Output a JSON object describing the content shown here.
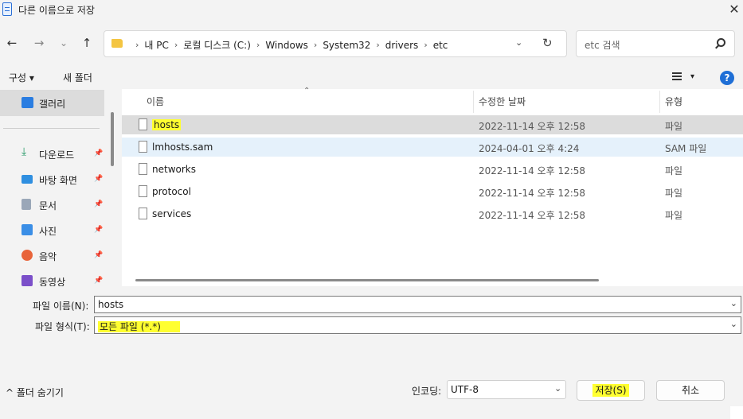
{
  "window": {
    "title": "다른 이름으로 저장",
    "close": "✕"
  },
  "nav": {
    "back": "←",
    "forward": "→",
    "recent": "⌄",
    "up": "↑"
  },
  "address": {
    "crumbs": [
      "내 PC",
      "로컬 디스크 (C:)",
      "Windows",
      "System32",
      "drivers",
      "etc"
    ],
    "dropdown": "⌄",
    "refresh": "↻"
  },
  "search": {
    "placeholder": "etc 검색"
  },
  "toolbar": {
    "organize": "구성 ▾",
    "new_folder": "새 폴더",
    "view_chevron": "▾",
    "help": "?"
  },
  "sidebar": {
    "selected": "갤러리",
    "items": [
      {
        "label": "다운로드",
        "pin": "📌"
      },
      {
        "label": "바탕 화면",
        "pin": "📌"
      },
      {
        "label": "문서",
        "pin": "📌"
      },
      {
        "label": "사진",
        "pin": "📌"
      },
      {
        "label": "음악",
        "pin": "📌"
      },
      {
        "label": "동영상",
        "pin": "📌"
      }
    ]
  },
  "columns": {
    "name": "이름",
    "modified": "수정한 날짜",
    "type": "유형",
    "sort_indicator": "⌃"
  },
  "files": [
    {
      "name": "hosts",
      "date": "2022-11-14 오후 12:58",
      "type": "파일"
    },
    {
      "name": "lmhosts.sam",
      "date": "2024-04-01 오후 4:24",
      "type": "SAM 파일"
    },
    {
      "name": "networks",
      "date": "2022-11-14 오후 12:58",
      "type": "파일"
    },
    {
      "name": "protocol",
      "date": "2022-11-14 오후 12:58",
      "type": "파일"
    },
    {
      "name": "services",
      "date": "2022-11-14 오후 12:58",
      "type": "파일"
    }
  ],
  "form": {
    "filename_label": "파일 이름(N):",
    "filename_value": "hosts",
    "filetype_label": "파일 형식(T):",
    "filetype_value": "모든 파일  (*.*)",
    "chevron": "⌄"
  },
  "footer": {
    "hide_folders": "^  폴더 숨기기",
    "encoding_label": "인코딩:",
    "encoding_value": "UTF-8",
    "save": "저장(S)",
    "cancel": "취소"
  },
  "colors": {
    "selection": "#dcdcdc",
    "hover": "#e5f1fb",
    "highlight": "#ffff30",
    "accent": "#1f6fd6"
  }
}
